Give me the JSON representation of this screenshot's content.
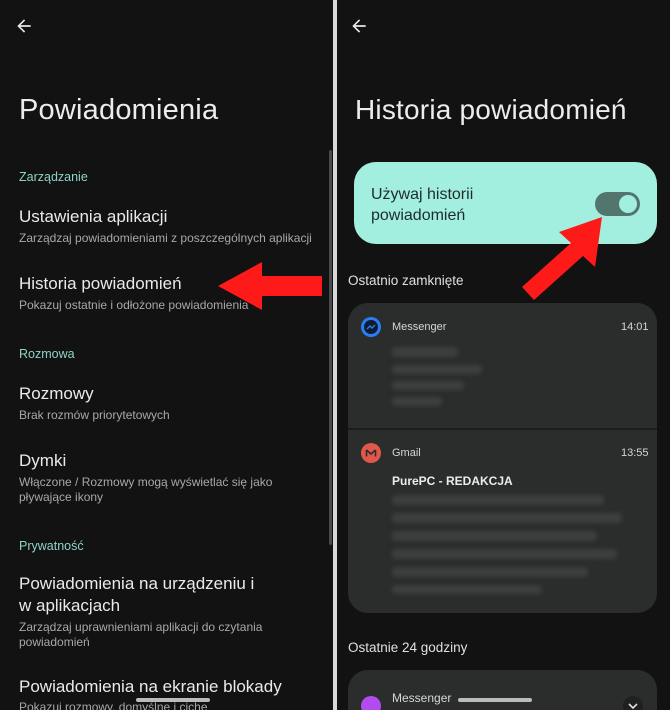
{
  "left": {
    "title": "Powiadomienia",
    "sections": {
      "manage": "Zarządzanie",
      "conversation": "Rozmowa",
      "privacy": "Prywatność"
    },
    "items": [
      {
        "title": "Ustawienia aplikacji",
        "subtitle": "Zarządzaj powiadomieniami z poszczególnych aplikacji"
      },
      {
        "title": "Historia powiadomień",
        "subtitle": "Pokazuj ostatnie i odłożone powiadomienia"
      },
      {
        "title": "Rozmowy",
        "subtitle": "Brak rozmów priorytetowych"
      },
      {
        "title": "Dymki",
        "subtitle": "Włączone / Rozmowy mogą wyświetlać się jako pływające ikony"
      },
      {
        "title": "Powiadomienia na urządzeniu i w aplikacjach",
        "subtitle": "Zarządzaj uprawnieniami aplikacji do czytania powiadomień"
      },
      {
        "title": "Powiadomienia na ekranie blokady",
        "subtitle": "Pokazuj rozmowy, domyślne i ciche"
      }
    ]
  },
  "right": {
    "title": "Historia powiadomień",
    "toggle": {
      "label": "Używaj historii powiadomień",
      "on": true
    },
    "recent_heading": "Ostatnio zamknięte",
    "notifications": [
      {
        "app": "Messenger",
        "time": "14:01",
        "heading": ""
      },
      {
        "app": "Gmail",
        "time": "13:55",
        "heading": "PurePC - REDAKCJA"
      }
    ],
    "last24_heading": "Ostatnie 24 godziny",
    "last24_items": [
      {
        "app": "Messenger"
      }
    ]
  },
  "colors": {
    "background": "#121212",
    "accent": "#8fd3c6",
    "toggle_card": "#a2efe0",
    "arrow": "#ff1a1a",
    "messenger_icon": "#2a7ef5",
    "gmail_icon": "#e2574c"
  }
}
